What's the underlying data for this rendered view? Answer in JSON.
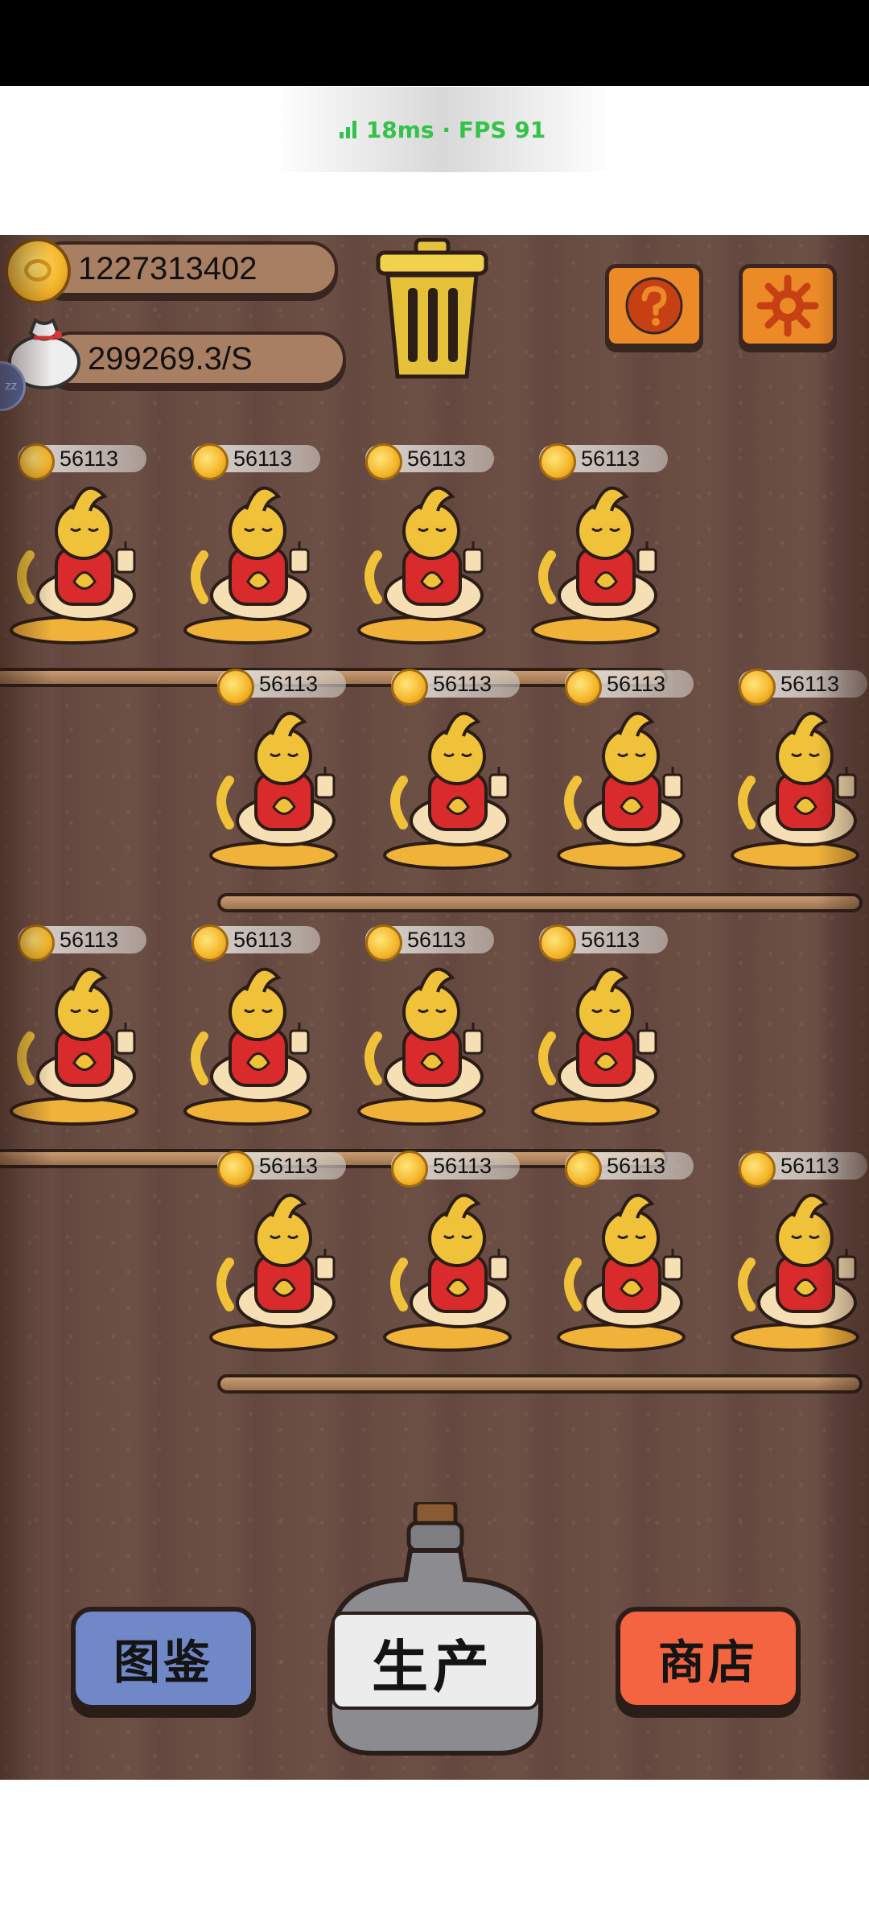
{
  "perf": {
    "text": "18ms · FPS 91"
  },
  "hud": {
    "coins": "1227313402",
    "rate": "299269.3/S",
    "side_handle": "zz"
  },
  "cat_price": "56113",
  "buttons": {
    "catalog": "图鉴",
    "produce": "生产",
    "shop": "商店"
  },
  "colors": {
    "wood": "#6a4d42",
    "catalog": "#7088c8",
    "shop": "#f56440",
    "hud_button": "#ec8a28",
    "perf_text": "#35c24a"
  },
  "icons": [
    "coin-icon",
    "money-bag-icon",
    "trash-can-icon",
    "help-icon",
    "settings-icon",
    "bottle-icon"
  ]
}
